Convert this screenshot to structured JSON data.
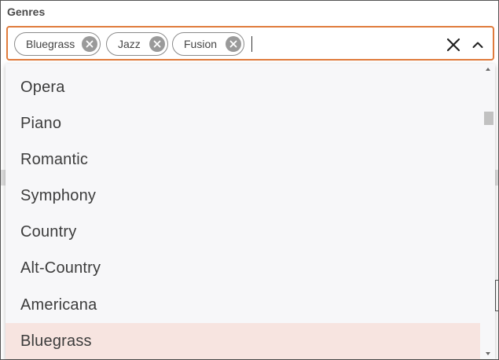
{
  "field": {
    "label": "Genres"
  },
  "selected_chips": [
    {
      "label": "Bluegrass",
      "remove_icon": "close-circle-icon"
    },
    {
      "label": "Jazz",
      "remove_icon": "close-circle-icon"
    },
    {
      "label": "Fusion",
      "remove_icon": "close-circle-icon"
    }
  ],
  "input": {
    "value": "",
    "placeholder": ""
  },
  "controls": {
    "clear_icon": "close-icon",
    "toggle_icon": "chevron-up-icon"
  },
  "options": [
    {
      "label": "Opera",
      "highlighted": false
    },
    {
      "label": "Piano",
      "highlighted": false
    },
    {
      "label": "Romantic",
      "highlighted": false
    },
    {
      "label": "Symphony",
      "highlighted": false
    },
    {
      "label": "Country",
      "highlighted": false
    },
    {
      "label": "Alt-Country",
      "highlighted": false
    },
    {
      "label": "Americana",
      "highlighted": false
    },
    {
      "label": "Bluegrass",
      "highlighted": true
    }
  ],
  "colors": {
    "focus_border": "#e07b3c",
    "highlight_bg": "#f7e4e0",
    "list_bg": "#f7f7f9"
  }
}
